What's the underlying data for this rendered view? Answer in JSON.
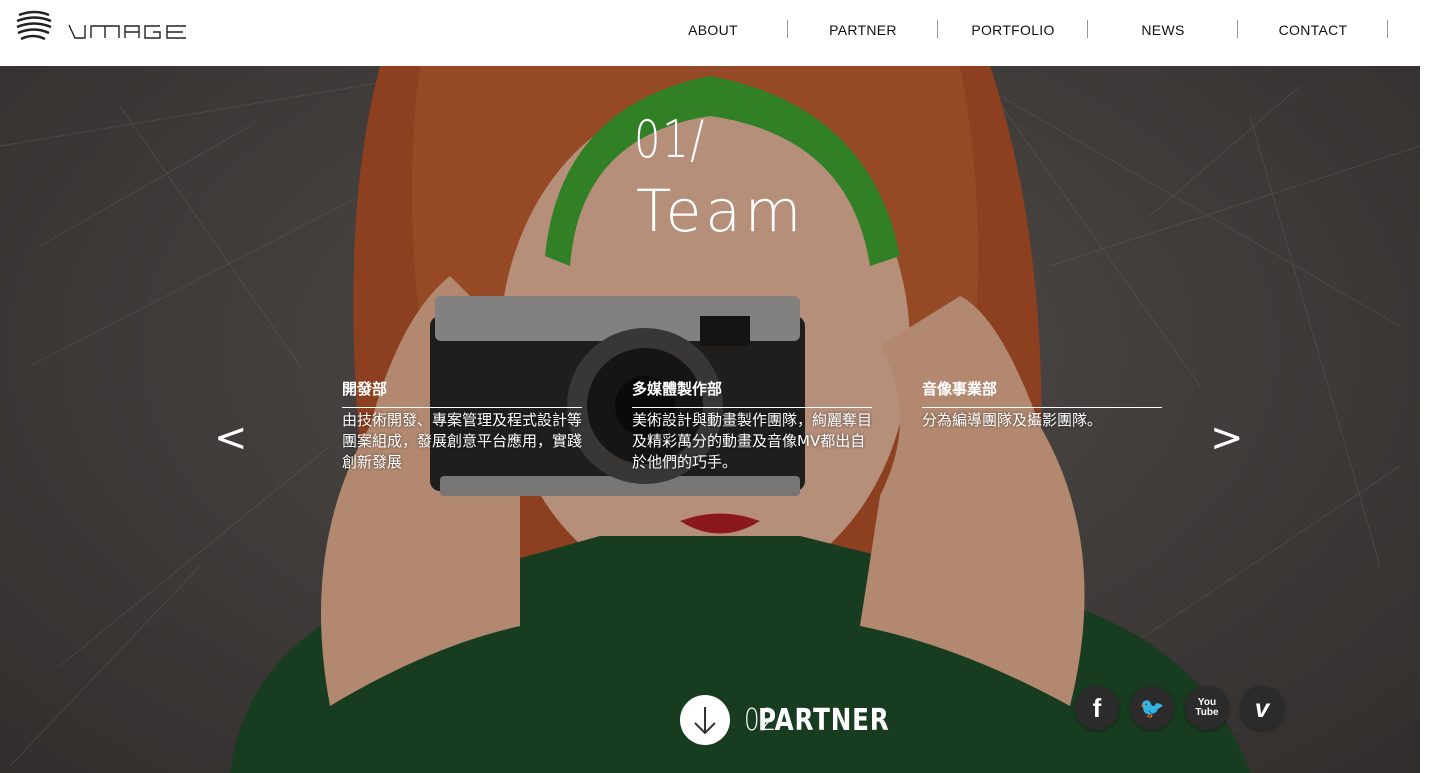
{
  "header": {
    "logo_text": "VMAGE",
    "nav": [
      {
        "label": "ABOUT"
      },
      {
        "label": "PARTNER"
      },
      {
        "label": "PORTFOLIO"
      },
      {
        "label": "NEWS"
      },
      {
        "label": "CONTACT"
      }
    ]
  },
  "hero": {
    "slide_number": "01/",
    "slide_title": "Team",
    "prev_arrow": "<",
    "next_arrow": ">",
    "departments": [
      {
        "title": "開發部",
        "description": "由技術開發、專案管理及程式設計等團案組成，發展創意平台應用，實踐創新發展"
      },
      {
        "title": "多媒體製作部",
        "description": "美術設計與動畫製作團隊，絢麗奪目及精彩萬分的動畫及音像MV都出自於他們的巧手。"
      },
      {
        "title": "音像事業部",
        "description": "分為編導團隊及攝影團隊。"
      }
    ],
    "next_section": {
      "number": "02",
      "label": "PARTNER"
    },
    "social": [
      {
        "icon": "facebook-icon",
        "glyph": "f"
      },
      {
        "icon": "twitter-icon",
        "glyph": "🐦"
      },
      {
        "icon": "youtube-icon",
        "glyph": "You Tube"
      },
      {
        "icon": "vimeo-icon",
        "glyph": "v"
      }
    ]
  },
  "colors": {
    "header_bg": "#ffffff",
    "nav_text": "#111111",
    "hero_text": "#ffffff",
    "headband_green": "#3fa531",
    "sweater_green": "#1f4d2a",
    "hair": "#b5532a"
  }
}
